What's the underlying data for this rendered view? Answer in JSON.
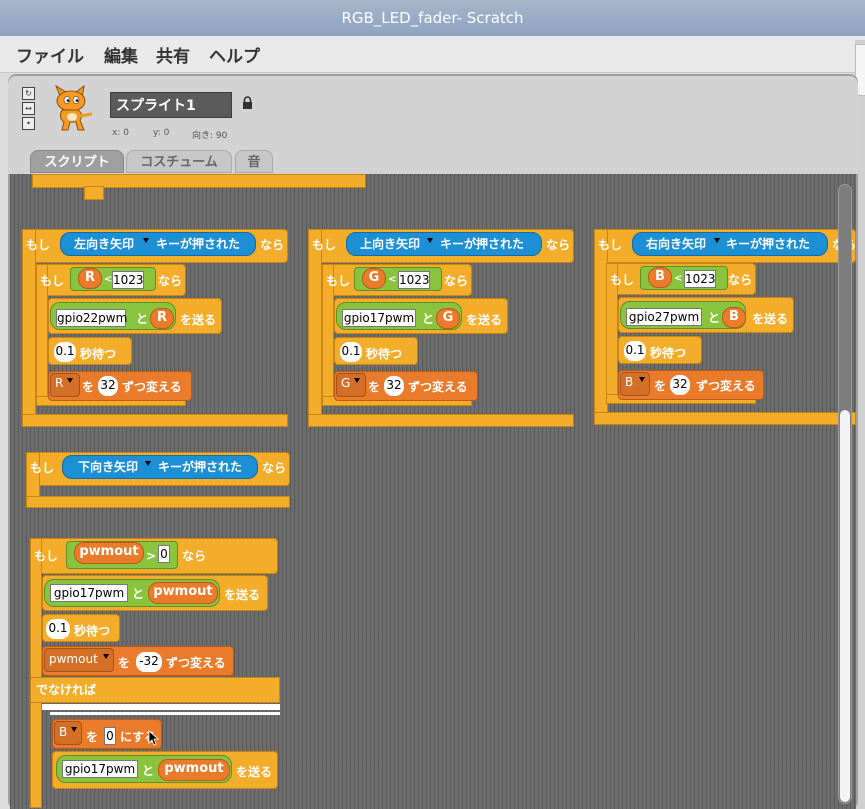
{
  "window": {
    "title": "RGB_LED_fader- Scratch"
  },
  "menu": [
    "ファイル",
    "編集",
    "共有",
    "ヘルプ"
  ],
  "sprite": {
    "name": "スプライト1",
    "x_label": "x: 0",
    "y_label": "y: 0",
    "direction_label": "向き: 90"
  },
  "tabs": [
    "スクリプト",
    "コスチューム",
    "音"
  ],
  "blocks": {
    "if": "もし",
    "then": "なら",
    "else": "でなければ",
    "key_pressed": "キーが押された",
    "left_arrow": "左向き矢印",
    "up_arrow": "上向き矢印",
    "right_arrow": "右向き矢印",
    "down_arrow": "下向き矢印",
    "lt": "<",
    "gt": ">",
    "to": "と",
    "send": "を送る",
    "wait_sec": "秒待つ",
    "wo": "を",
    "change_by": "ずつ変える",
    "set_to": "にする",
    "var_r": "R",
    "var_g": "G",
    "var_b": "B",
    "var_pwmout": "pwmout",
    "n1023": "1023",
    "gpio22": "gpio22pwm",
    "gpio17": "gpio17pwm",
    "gpio27": "gpio27pwm",
    "wait": "0.1",
    "change_pos": "32",
    "change_neg": "-32",
    "zero": "0"
  }
}
